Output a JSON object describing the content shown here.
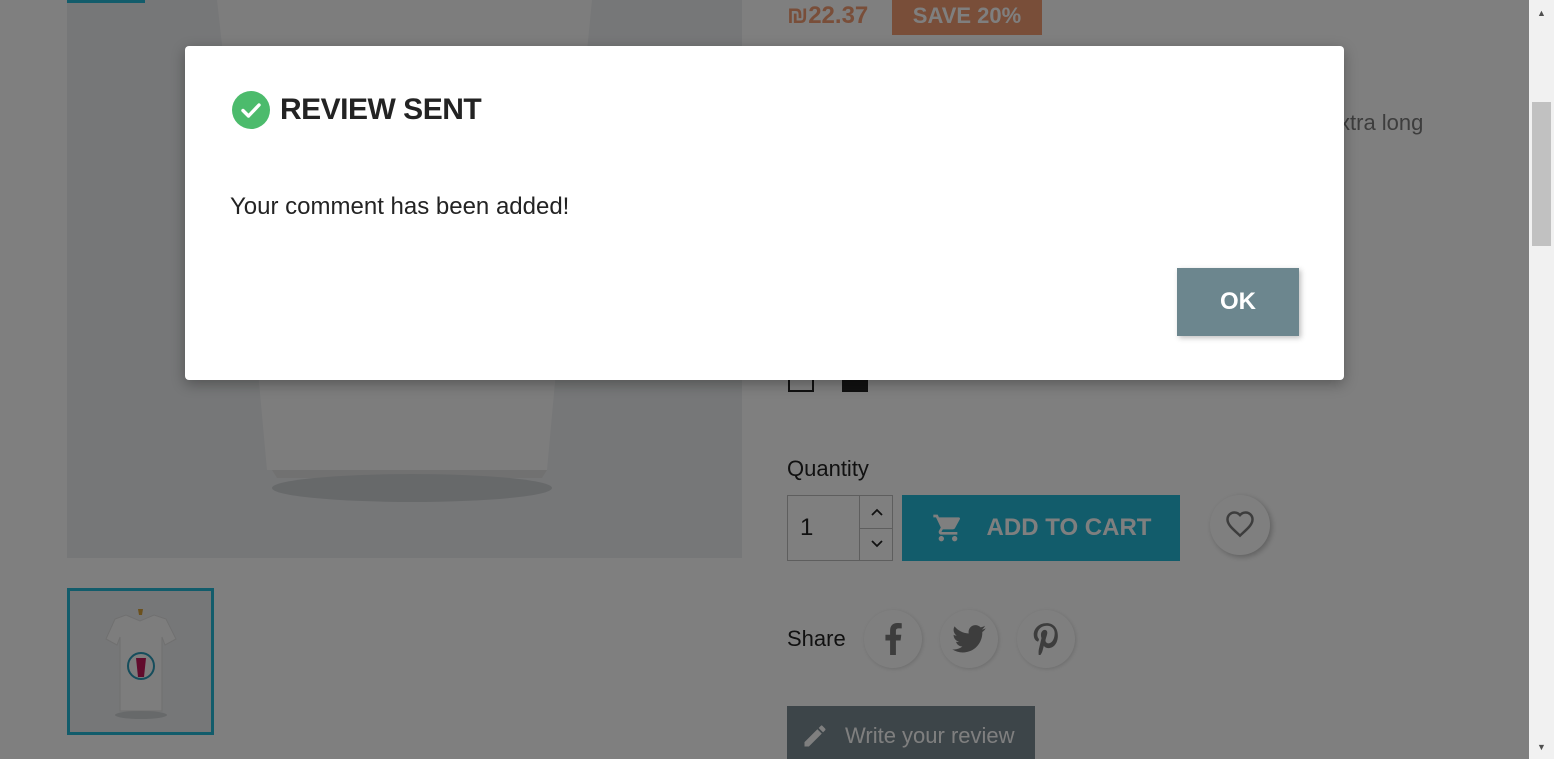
{
  "product": {
    "price": "₪22.37",
    "discount": "SAVE 20%",
    "description_fragment": "xtra long",
    "quantity_label": "Quantity",
    "quantity_value": "1",
    "add_to_cart_label": "ADD TO CART",
    "share_label": "Share",
    "write_review_label": "Write your review"
  },
  "icons": {
    "cart": "cart-icon",
    "heart": "heart-icon",
    "facebook": "facebook-icon",
    "twitter": "twitter-icon",
    "pinterest": "pinterest-icon",
    "pencil": "pencil-icon",
    "check": "check-circle-icon",
    "chevron_up": "chevron-up-icon",
    "chevron_down": "chevron-down-icon"
  },
  "modal": {
    "title": "REVIEW SENT",
    "message": "Your comment has been added!",
    "ok_label": "OK"
  },
  "colors": {
    "accent": "#24b9d7",
    "price": "#f39d72",
    "success": "#4cbb6c",
    "ok_button": "#6c868e",
    "review_button": "#7a8a93"
  }
}
